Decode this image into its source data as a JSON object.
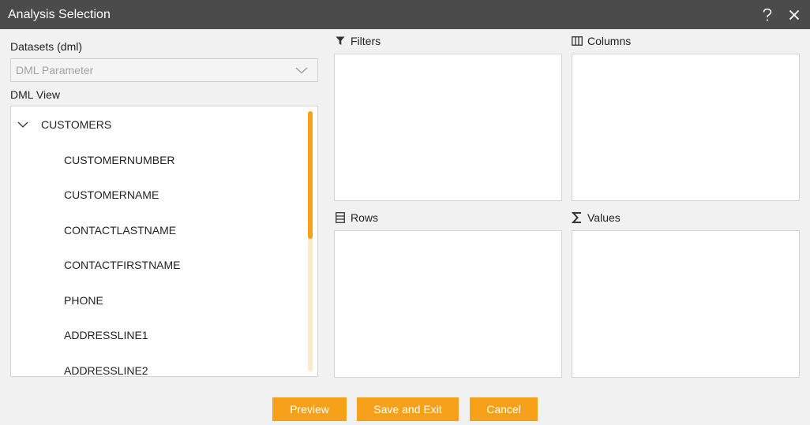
{
  "window": {
    "title": "Analysis Selection",
    "help_icon": "question-icon",
    "close_icon": "close-icon"
  },
  "datasets": {
    "label": "Datasets (dml)",
    "selected": "DML Parameter"
  },
  "dml_view": {
    "label": "DML View",
    "root": "CUSTOMERS",
    "fields": [
      "CUSTOMERNUMBER",
      "CUSTOMERNAME",
      "CONTACTLASTNAME",
      "CONTACTFIRSTNAME",
      "PHONE",
      "ADDRESSLINE1",
      "ADDRESSLINE2"
    ]
  },
  "sections": {
    "filters": "Filters",
    "columns": "Columns",
    "rows": "Rows",
    "values": "Values"
  },
  "buttons": {
    "preview": "Preview",
    "save_exit": "Save and Exit",
    "cancel": "Cancel"
  },
  "colors": {
    "accent": "#f7a11a",
    "titlebar": "#4b4b4b"
  }
}
